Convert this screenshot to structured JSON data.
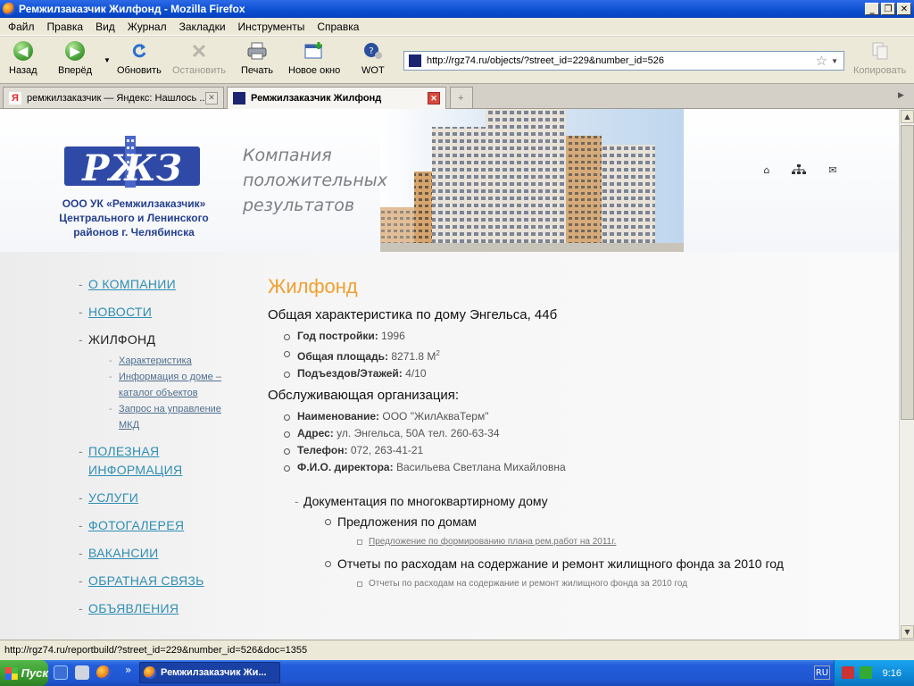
{
  "window": {
    "title": "Ремжилзаказчик Жилфонд - Mozilla Firefox"
  },
  "menu": [
    "Файл",
    "Правка",
    "Вид",
    "Журнал",
    "Закладки",
    "Инструменты",
    "Справка"
  ],
  "toolbar": {
    "back": "Назад",
    "forward": "Вперёд",
    "reload": "Обновить",
    "stop": "Остановить",
    "print": "Печать",
    "new_window": "Новое окно",
    "wot": "WOT",
    "copy": "Копировать"
  },
  "address": {
    "url": "http://rgz74.ru/objects/?street_id=229&number_id=526"
  },
  "tabs": [
    {
      "label": "ремжилзаказчик — Яндекс: Нашлось ..."
    },
    {
      "label": "Ремжилзаказчик Жилфонд"
    }
  ],
  "header": {
    "logo_text": "РЖЗ",
    "company": [
      "ООО УК «Ремжилзаказчик»",
      "Центрального и Ленинского",
      "районов г. Челябинска"
    ],
    "slogan": [
      "Компания",
      "положительных",
      "результатов"
    ]
  },
  "nav": {
    "items": [
      {
        "label": "О КОМПАНИИ"
      },
      {
        "label": "НОВОСТИ"
      },
      {
        "label": "ЖИЛФОНД"
      },
      {
        "label": "ПОЛЕЗНАЯ ИНФОРМАЦИЯ"
      },
      {
        "label": "УСЛУГИ"
      },
      {
        "label": "ФОТОГАЛЕРЕЯ"
      },
      {
        "label": "ВАКАНСИИ"
      },
      {
        "label": "ОБРАТНАЯ СВЯЗЬ"
      },
      {
        "label": "ОБЪЯВЛЕНИЯ"
      }
    ],
    "sub": [
      "Характеристика",
      "Информация о доме – каталог объектов",
      "Запрос на управление МКД"
    ]
  },
  "main": {
    "title": "Жилфонд",
    "general_heading": "Общая характеристика по дому Энгельса, 44б",
    "general": [
      {
        "label": "Год постройки:",
        "value": "1996"
      },
      {
        "label": "Общая площадь:",
        "value": "8271.8 М",
        "sup": "2"
      },
      {
        "label": "Подъездов/Этажей:",
        "value": "4/10"
      }
    ],
    "org_heading": "Обслуживающая организация:",
    "org": [
      {
        "label": "Наименование:",
        "value": "ООО \"ЖилАкваТерм\""
      },
      {
        "label": "Адрес:",
        "value": "ул. Энгельса, 50А тел. 260-63-34"
      },
      {
        "label": "Телефон:",
        "value": "072, 263-41-21"
      },
      {
        "label": "Ф.И.О. директора:",
        "value": "Васильева Светлана Михайловна"
      }
    ],
    "docs_heading": "Документация по многоквартирному дому",
    "docs": [
      {
        "heading": "Предложения по домам",
        "link": "Предложение по формированию плана рем.работ на 2011г."
      },
      {
        "heading": "Отчеты по расходам на содержание и ремонт жилищного фонда за 2010 год",
        "link": "Отчеты по расходам на содержание и ремонт жилищного фонда за 2010 год"
      }
    ]
  },
  "status": {
    "text": "http://rgz74.ru/reportbuild/?street_id=229&number_id=526&doc=1355"
  },
  "taskbar": {
    "start": "Пуск",
    "quick_more": "»",
    "task": "Ремжилзаказчик Жи...",
    "lang": "RU",
    "clock": "9:16"
  },
  "colors": {
    "accent_orange": "#f0a030",
    "link_blue": "#2f8eb4",
    "brand_blue": "#25408f"
  }
}
